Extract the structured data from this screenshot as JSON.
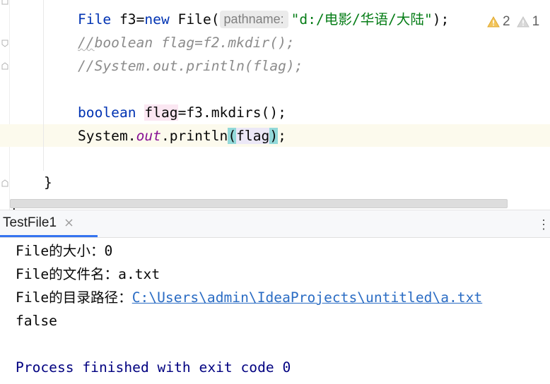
{
  "editor": {
    "lines": {
      "l1": {
        "kw1": "File",
        "t1": " f3=",
        "kw2": "new",
        "t2": " File(",
        "hint": "pathname:",
        "str": "\"d:/电影/华语/大陆\"",
        "t3": ");"
      },
      "l2": {
        "cmt_a": "//",
        "cmt_b": "boolean flag=f2.mkdir();"
      },
      "l3": {
        "cmt": "//System.out.println(flag);"
      },
      "l5": {
        "kw": "boolean",
        "var": "flag",
        "rest": "=f3.mkdirs();"
      },
      "l6": {
        "t1": "System.",
        "fld": "out",
        "t2": ".println",
        "paren_open": "(",
        "var": "flag",
        "paren_close": ")",
        "t3": ";"
      },
      "l8": {
        "brace": "}"
      },
      "l9": {
        "brace": "}"
      }
    },
    "inspections": {
      "warning_count": "2",
      "weak_warning_count": "1",
      "warning_color": "#f2c55c",
      "weak_warning_color": "#d8d8d8"
    }
  },
  "run_window": {
    "tab_label": "TestFile1",
    "more_glyph": "⋮",
    "accent": "#3574f0"
  },
  "console": {
    "line1": "File的大小：0",
    "line2": "File的文件名：a.txt",
    "line3_prefix": "File的目录路径：",
    "line3_link": "C:\\Users\\admin\\IdeaProjects\\untitled\\a.txt",
    "line4": "false",
    "exit_message": "Process finished with exit code 0"
  }
}
